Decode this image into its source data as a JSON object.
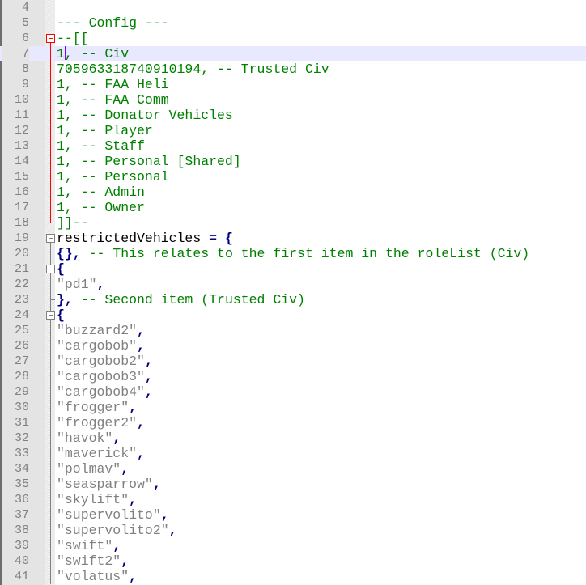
{
  "editor": {
    "current_line": 7,
    "lines": [
      {
        "n": "4",
        "tokens": []
      },
      {
        "n": "5",
        "tokens": [
          {
            "t": "--- Config ---",
            "c": "cmt"
          }
        ]
      },
      {
        "n": "6",
        "tokens": [
          {
            "t": "--[[",
            "c": "cmt"
          }
        ],
        "fold": "start-red"
      },
      {
        "n": "7",
        "tokens": [
          {
            "t": "1",
            "c": "cmt"
          },
          {
            "caret": true
          },
          {
            "t": ", -- Civ",
            "c": "cmt"
          }
        ],
        "fold": "mid-red"
      },
      {
        "n": "8",
        "tokens": [
          {
            "t": "705963318740910194, -- Trusted Civ",
            "c": "cmt"
          }
        ],
        "fold": "mid-red"
      },
      {
        "n": "9",
        "tokens": [
          {
            "t": "1, -- FAA Heli",
            "c": "cmt"
          }
        ],
        "fold": "mid-red"
      },
      {
        "n": "10",
        "tokens": [
          {
            "t": "1, -- FAA Comm",
            "c": "cmt"
          }
        ],
        "fold": "mid-red"
      },
      {
        "n": "11",
        "tokens": [
          {
            "t": "1, -- Donator Vehicles",
            "c": "cmt"
          }
        ],
        "fold": "mid-red"
      },
      {
        "n": "12",
        "tokens": [
          {
            "t": "1, -- Player",
            "c": "cmt"
          }
        ],
        "fold": "mid-red"
      },
      {
        "n": "13",
        "tokens": [
          {
            "t": "1, -- Staff",
            "c": "cmt"
          }
        ],
        "fold": "mid-red"
      },
      {
        "n": "14",
        "tokens": [
          {
            "t": "1, -- Personal [Shared]",
            "c": "cmt"
          }
        ],
        "fold": "mid-red"
      },
      {
        "n": "15",
        "tokens": [
          {
            "t": "1, -- Personal",
            "c": "cmt"
          }
        ],
        "fold": "mid-red"
      },
      {
        "n": "16",
        "tokens": [
          {
            "t": "1, -- Admin",
            "c": "cmt"
          }
        ],
        "fold": "mid-red"
      },
      {
        "n": "17",
        "tokens": [
          {
            "t": "1, -- Owner",
            "c": "cmt"
          }
        ],
        "fold": "mid-red"
      },
      {
        "n": "18",
        "tokens": [
          {
            "t": "]]--",
            "c": "cmt"
          }
        ],
        "fold": "end-red"
      },
      {
        "n": "19",
        "tokens": [
          {
            "t": "restrictedVehicles",
            "c": "id"
          },
          {
            "t": " = ",
            "c": "op"
          },
          {
            "t": "{",
            "c": "op"
          }
        ],
        "fold": "start"
      },
      {
        "n": "20",
        "tokens": [
          {
            "t": "{}",
            "c": "op"
          },
          {
            "t": ",",
            "c": "op"
          },
          {
            "t": " -- This relates to the first item in the roleList (Civ)",
            "c": "cmt"
          }
        ],
        "fold": "mid"
      },
      {
        "n": "21",
        "tokens": [
          {
            "t": "{",
            "c": "op"
          }
        ],
        "fold": "start-inner"
      },
      {
        "n": "22",
        "tokens": [
          {
            "t": "\"pd1\"",
            "c": "str"
          },
          {
            "t": ",",
            "c": "op"
          }
        ],
        "fold": "mid"
      },
      {
        "n": "23",
        "tokens": [
          {
            "t": "}",
            "c": "op"
          },
          {
            "t": ",",
            "c": "op"
          },
          {
            "t": " -- Second item (Trusted Civ)",
            "c": "cmt"
          }
        ],
        "fold": "end-inner"
      },
      {
        "n": "24",
        "tokens": [
          {
            "t": "{",
            "c": "op"
          }
        ],
        "fold": "start-inner"
      },
      {
        "n": "25",
        "tokens": [
          {
            "t": "\"buzzard2\"",
            "c": "str"
          },
          {
            "t": ",",
            "c": "op"
          }
        ],
        "fold": "mid"
      },
      {
        "n": "26",
        "tokens": [
          {
            "t": "\"cargobob\"",
            "c": "str"
          },
          {
            "t": ",",
            "c": "op"
          }
        ],
        "fold": "mid"
      },
      {
        "n": "27",
        "tokens": [
          {
            "t": "\"cargobob2\"",
            "c": "str"
          },
          {
            "t": ",",
            "c": "op"
          }
        ],
        "fold": "mid"
      },
      {
        "n": "28",
        "tokens": [
          {
            "t": "\"cargobob3\"",
            "c": "str"
          },
          {
            "t": ",",
            "c": "op"
          }
        ],
        "fold": "mid"
      },
      {
        "n": "29",
        "tokens": [
          {
            "t": "\"cargobob4\"",
            "c": "str"
          },
          {
            "t": ",",
            "c": "op"
          }
        ],
        "fold": "mid"
      },
      {
        "n": "30",
        "tokens": [
          {
            "t": "\"frogger\"",
            "c": "str"
          },
          {
            "t": ",",
            "c": "op"
          }
        ],
        "fold": "mid"
      },
      {
        "n": "31",
        "tokens": [
          {
            "t": "\"frogger2\"",
            "c": "str"
          },
          {
            "t": ",",
            "c": "op"
          }
        ],
        "fold": "mid"
      },
      {
        "n": "32",
        "tokens": [
          {
            "t": "\"havok\"",
            "c": "str"
          },
          {
            "t": ",",
            "c": "op"
          }
        ],
        "fold": "mid"
      },
      {
        "n": "33",
        "tokens": [
          {
            "t": "\"maverick\"",
            "c": "str"
          },
          {
            "t": ",",
            "c": "op"
          }
        ],
        "fold": "mid"
      },
      {
        "n": "34",
        "tokens": [
          {
            "t": "\"polmav\"",
            "c": "str"
          },
          {
            "t": ",",
            "c": "op"
          }
        ],
        "fold": "mid"
      },
      {
        "n": "35",
        "tokens": [
          {
            "t": "\"seasparrow\"",
            "c": "str"
          },
          {
            "t": ",",
            "c": "op"
          }
        ],
        "fold": "mid"
      },
      {
        "n": "36",
        "tokens": [
          {
            "t": "\"skylift\"",
            "c": "str"
          },
          {
            "t": ",",
            "c": "op"
          }
        ],
        "fold": "mid"
      },
      {
        "n": "37",
        "tokens": [
          {
            "t": "\"supervolito\"",
            "c": "str"
          },
          {
            "t": ",",
            "c": "op"
          }
        ],
        "fold": "mid"
      },
      {
        "n": "38",
        "tokens": [
          {
            "t": "\"supervolito2\"",
            "c": "str"
          },
          {
            "t": ",",
            "c": "op"
          }
        ],
        "fold": "mid"
      },
      {
        "n": "39",
        "tokens": [
          {
            "t": "\"swift\"",
            "c": "str"
          },
          {
            "t": ",",
            "c": "op"
          }
        ],
        "fold": "mid"
      },
      {
        "n": "40",
        "tokens": [
          {
            "t": "\"swift2\"",
            "c": "str"
          },
          {
            "t": ",",
            "c": "op"
          }
        ],
        "fold": "mid"
      },
      {
        "n": "41",
        "tokens": [
          {
            "t": "\"volatus\"",
            "c": "str"
          },
          {
            "t": ",",
            "c": "op"
          }
        ],
        "fold": "mid"
      }
    ]
  }
}
